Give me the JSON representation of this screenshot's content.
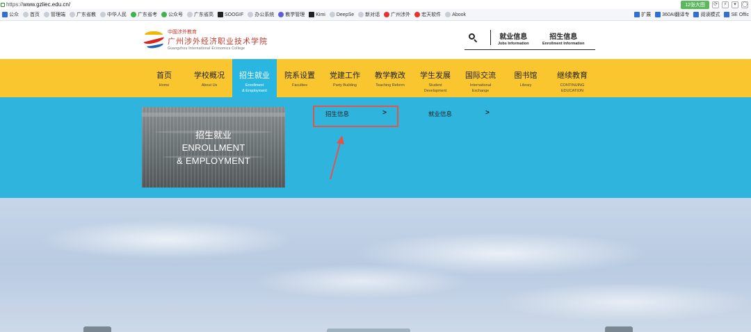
{
  "browser": {
    "url_scheme": "https://",
    "url_host": "www.gzliec.edu.cn/",
    "right_tag": "12张大图",
    "bookmarks_left": [
      "公众",
      "首页",
      "管理端",
      "广东省教",
      "中华人民",
      "广东省考",
      "公众号",
      "广东省高",
      "SOOGIF",
      "办公系统",
      "教学管理",
      "Kimi",
      "DeepSe",
      "新对话",
      "广州涉外",
      "宏天软件",
      "Abook"
    ],
    "bookmarks_right": [
      "扩展",
      "360AI翻译专",
      "阅读模式",
      "SE Offic"
    ]
  },
  "header": {
    "logo_top": "中國涉外教育",
    "logo_name": "广州涉外经济职业技术学院",
    "logo_en": "Guangzhou International Economics College",
    "jobs_zh": "就业信息",
    "jobs_en": "Jobs Information",
    "enroll_zh": "招生信息",
    "enroll_en": "Enrollment Information"
  },
  "nav": [
    {
      "zh": "首页",
      "en": "Home"
    },
    {
      "zh": "学校概况",
      "en": "About Us"
    },
    {
      "zh": "招生就业",
      "en": "Enrollment",
      "en2": "& Employment"
    },
    {
      "zh": "院系设置",
      "en": "Faculties"
    },
    {
      "zh": "党建工作",
      "en": "Party Building"
    },
    {
      "zh": "教学教改",
      "en": "Teaching Reform"
    },
    {
      "zh": "学生发展",
      "en": "Student",
      "en2": "Development"
    },
    {
      "zh": "国际交流",
      "en": "International",
      "en2": "Exchange"
    },
    {
      "zh": "图书馆",
      "en": "Library"
    },
    {
      "zh": "继续教育",
      "en": "CONTINUING",
      "en2": "EDUCATION"
    }
  ],
  "dropdown": {
    "caption_zh": "招生就业",
    "caption_en1": "ENROLLMENT",
    "caption_en2": "& EMPLOYMENT",
    "link_enroll": "招生信息",
    "link_jobs": "就业信息",
    "chevron": ">"
  },
  "colors": {
    "nav_bg": "#f9c630",
    "active_bg": "#29b6e0",
    "dropdown_bg": "#2fb5dd",
    "annotation": "#e0564a"
  }
}
